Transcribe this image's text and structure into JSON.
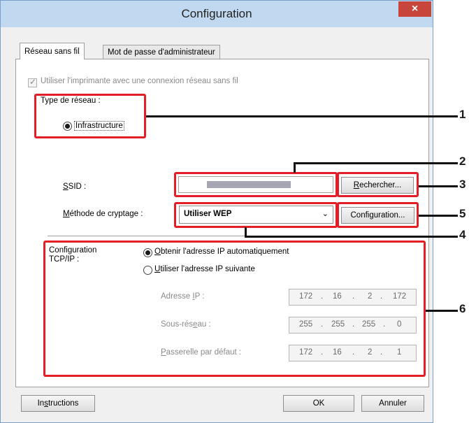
{
  "window": {
    "title": "Configuration",
    "close_glyph": "×"
  },
  "tabs": [
    {
      "label": "Réseau sans fil",
      "active": true
    },
    {
      "label": "Mot de passe d'administrateur",
      "active": false
    }
  ],
  "wireless": {
    "use_wireless_checkbox": {
      "label": "Utiliser l'imprimante avec une connexion réseau sans fil",
      "checked": true,
      "enabled": false
    },
    "network_type_label": "Type de réseau :",
    "infrastructure_radio": {
      "label": "Infrastructure",
      "selected": true
    },
    "ssid_label": "SSID :",
    "ssid_value": "",
    "search_button": "Rechercher...",
    "encryption_label": "Méthode de cryptage :",
    "encryption_selected": "Utiliser WEP",
    "encryption_config_button": "Configuration..."
  },
  "tcpip": {
    "section_label_line1": "Configuration",
    "section_label_line2": "TCP/IP :",
    "auto_radio": {
      "label": "Obtenir l'adresse IP automatiquement",
      "selected": true
    },
    "manual_radio": {
      "label": "Utiliser l'adresse IP suivante",
      "selected": false
    },
    "ip_label": "Adresse IP :",
    "ip_octets": [
      "172",
      "16",
      "2",
      "172"
    ],
    "subnet_label": "Sous-réseau :",
    "subnet_octets": [
      "255",
      "255",
      "255",
      "0"
    ],
    "gateway_label": "Passerelle par défaut :",
    "gateway_octets": [
      "172",
      "16",
      "2",
      "1"
    ]
  },
  "footer": {
    "instructions_button": "Instructions",
    "ok_button": "OK",
    "cancel_button": "Annuler"
  },
  "callouts": [
    "1",
    "2",
    "3",
    "4",
    "5",
    "6"
  ],
  "colors": {
    "highlight": "#e41e26",
    "title_bar": "#c0d8f0",
    "close_button": "#c7453a"
  }
}
